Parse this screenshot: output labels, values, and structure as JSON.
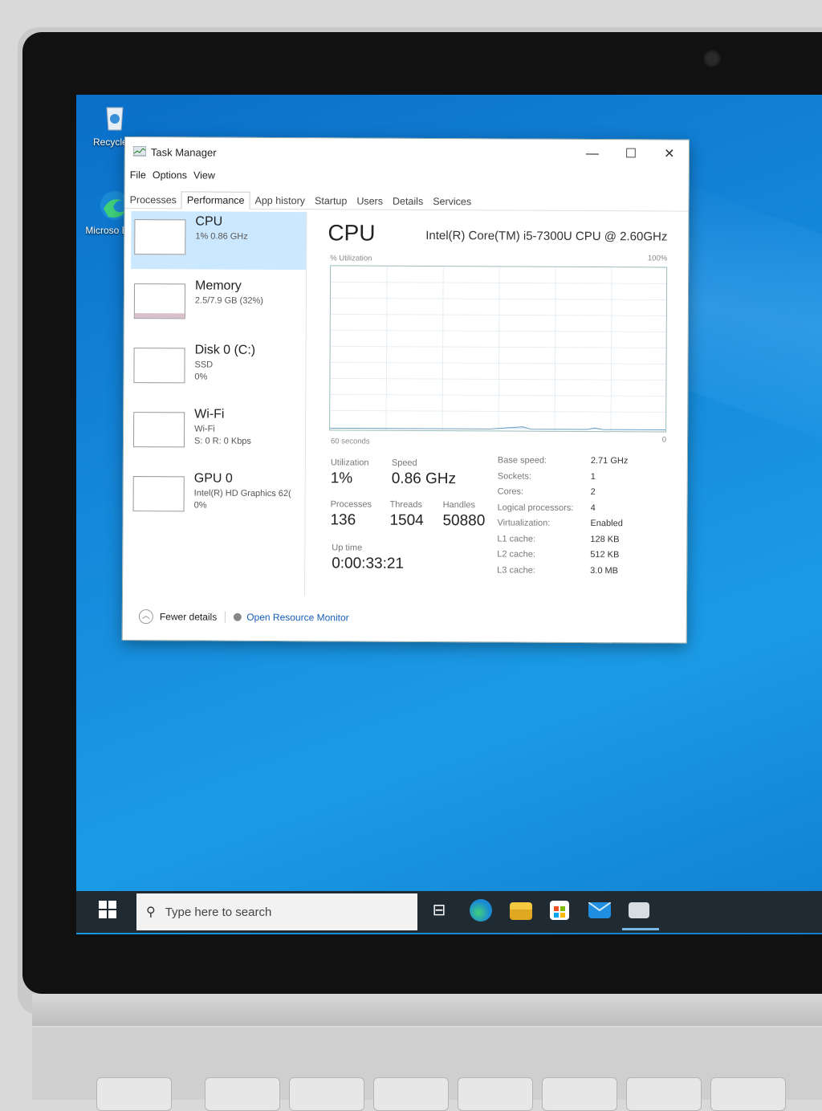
{
  "desktop": {
    "icons": [
      {
        "label": "Recycle B",
        "icon": "recycle-bin-icon"
      },
      {
        "label": "Microso Edge",
        "icon": "edge-icon"
      }
    ]
  },
  "window": {
    "title": "Task Manager",
    "controls": {
      "minimize": "—",
      "maximize": "☐",
      "close": "✕"
    },
    "menu": [
      "File",
      "Options",
      "View"
    ],
    "tabs": [
      "Processes",
      "Performance",
      "App history",
      "Startup",
      "Users",
      "Details",
      "Services"
    ],
    "active_tab": "Performance"
  },
  "resources": [
    {
      "name": "CPU",
      "sub1": "1% 0.86 GHz",
      "sub2": "",
      "selected": true
    },
    {
      "name": "Memory",
      "sub1": "2.5/7.9 GB (32%)",
      "sub2": "",
      "selected": false
    },
    {
      "name": "Disk 0 (C:)",
      "sub1": "SSD",
      "sub2": "0%",
      "selected": false
    },
    {
      "name": "Wi-Fi",
      "sub1": "Wi-Fi",
      "sub2": "S: 0 R: 0 Kbps",
      "selected": false
    },
    {
      "name": "GPU 0",
      "sub1": "Intel(R) HD Graphics 62(",
      "sub2": "0%",
      "selected": false
    }
  ],
  "detail": {
    "title": "CPU",
    "cpu_name": "Intel(R) Core(TM) i5-7300U CPU @ 2.60GHz",
    "graph_label": "% Utilization",
    "graph_max": "100%",
    "graph_time": "60 seconds",
    "graph_min": "0",
    "utilization_label": "Utilization",
    "utilization": "1%",
    "speed_label": "Speed",
    "speed": "0.86 GHz",
    "processes_label": "Processes",
    "processes": "136",
    "threads_label": "Threads",
    "threads": "1504",
    "handles_label": "Handles",
    "handles": "50880",
    "uptime_label": "Up time",
    "uptime": "0:00:33:21",
    "specs": [
      {
        "k": "Base speed:",
        "v": "2.71 GHz"
      },
      {
        "k": "Sockets:",
        "v": "1"
      },
      {
        "k": "Cores:",
        "v": "2"
      },
      {
        "k": "Logical processors:",
        "v": "4"
      },
      {
        "k": "Virtualization:",
        "v": "Enabled"
      },
      {
        "k": "L1 cache:",
        "v": "128 KB"
      },
      {
        "k": "L2 cache:",
        "v": "512 KB"
      },
      {
        "k": "L3 cache:",
        "v": "3.0 MB"
      }
    ]
  },
  "footer": {
    "fewer_details": "Fewer details",
    "open_monitor": "Open Resource Monitor"
  },
  "taskbar": {
    "search_placeholder": "Type here to search",
    "icons": [
      "task-view-icon",
      "edge-icon",
      "file-explorer-icon",
      "store-icon",
      "mail-icon",
      "task-manager-icon"
    ]
  },
  "colors": {
    "selection": "#cce8ff",
    "desktop": "#1589db",
    "taskbar": "#1f2a33",
    "link": "#1a5fb4"
  }
}
